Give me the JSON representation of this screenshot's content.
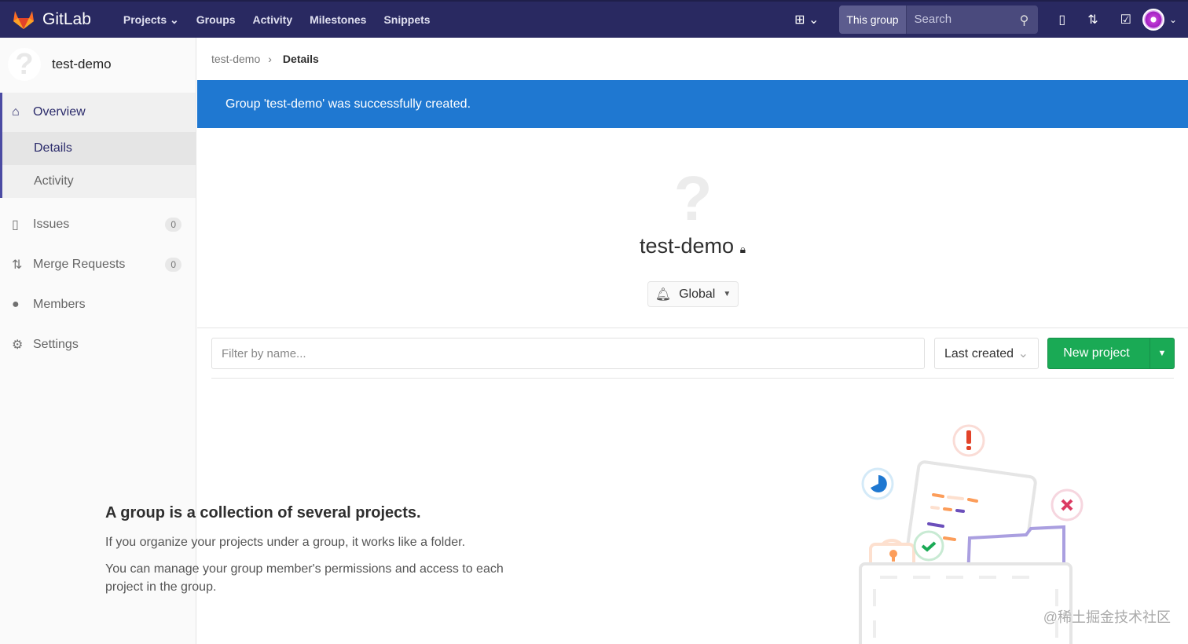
{
  "topbar": {
    "brand": "GitLab",
    "nav": [
      "Projects",
      "Groups",
      "Activity",
      "Milestones",
      "Snippets"
    ],
    "search_scope": "This group",
    "search_placeholder": "Search"
  },
  "sidebar": {
    "group_name": "test-demo",
    "overview": "Overview",
    "overview_items": [
      "Details",
      "Activity"
    ],
    "items": [
      {
        "label": "Issues",
        "count": "0"
      },
      {
        "label": "Merge Requests",
        "count": "0"
      },
      {
        "label": "Members"
      },
      {
        "label": "Settings"
      }
    ]
  },
  "breadcrumb": {
    "parent": "test-demo",
    "current": "Details"
  },
  "flash": "Group 'test-demo' was successfully created.",
  "group": {
    "title": "test-demo",
    "notification": "Global"
  },
  "filters": {
    "placeholder": "Filter by name...",
    "sort": "Last created",
    "new_project": "New project"
  },
  "empty": {
    "heading": "A group is a collection of several projects.",
    "p1": "If you organize your projects under a group, it works like a folder.",
    "p2": "You can manage your group member's permissions and access to each project in the group."
  },
  "watermark": "@稀土掘金技术社区",
  "colors": {
    "navbar": "#292961",
    "flash": "#1f78d1",
    "primary": "#1aaa55"
  }
}
